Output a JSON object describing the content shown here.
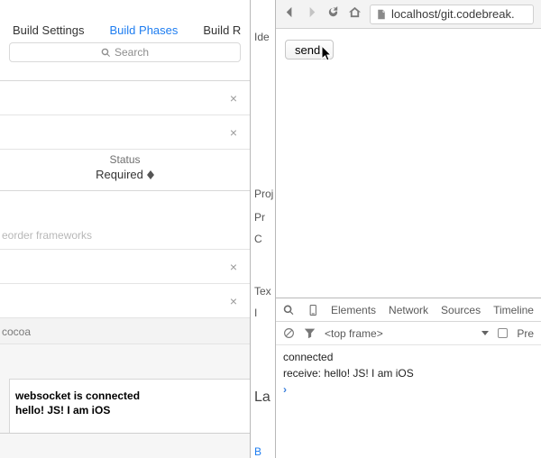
{
  "xcode": {
    "tabs": {
      "settings": "Build Settings",
      "phases": "Build Phases",
      "rules_partial": "Build R"
    },
    "search_placeholder": "Search",
    "status_header": "Status",
    "required_value": "Required",
    "reorder_hint": "eorder frameworks",
    "section_cocoa": "cocoa",
    "console": {
      "line1": "websocket is connected",
      "line2": "hello! JS! I am iOS"
    }
  },
  "sidepanel": {
    "identity": "Ide",
    "project": "Proj",
    "project_row": "Pr",
    "c_row": "C",
    "text": "Tex",
    "text_row": "I",
    "la": "La",
    "bu": "B"
  },
  "browser": {
    "url": "localhost/git.codebreak.",
    "send_label": "send!"
  },
  "devtools": {
    "tabs": {
      "elements": "Elements",
      "network": "Network",
      "sources": "Sources",
      "timeline": "Timeline"
    },
    "frame_label": "<top frame>",
    "preserve_partial": "Pre",
    "console": {
      "line1": "connected",
      "line2": "receive: hello! JS! I am iOS"
    }
  }
}
